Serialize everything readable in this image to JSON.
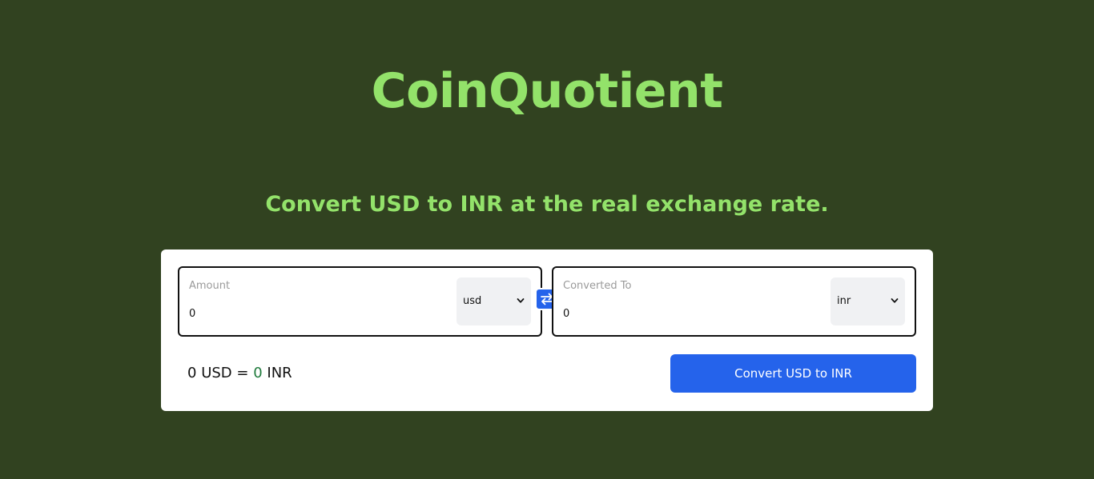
{
  "app": {
    "title": "CoinQuotient",
    "subtitle": "Convert USD to INR at the real exchange rate."
  },
  "converter": {
    "from": {
      "label": "Amount",
      "value": "0",
      "currency": "usd"
    },
    "to": {
      "label": "Converted To",
      "value": "0",
      "currency": "inr"
    },
    "swap_icon": "swap-arrows-icon",
    "result": {
      "amount": "0",
      "from_code": "USD",
      "equals": "=",
      "converted": "0",
      "to_code": "INR"
    },
    "convert_button_label": "Convert USD to INR"
  },
  "colors": {
    "background": "#314220",
    "heading": "#93e26a",
    "accent": "#2563eb",
    "result_value": "#1f7a3c"
  }
}
